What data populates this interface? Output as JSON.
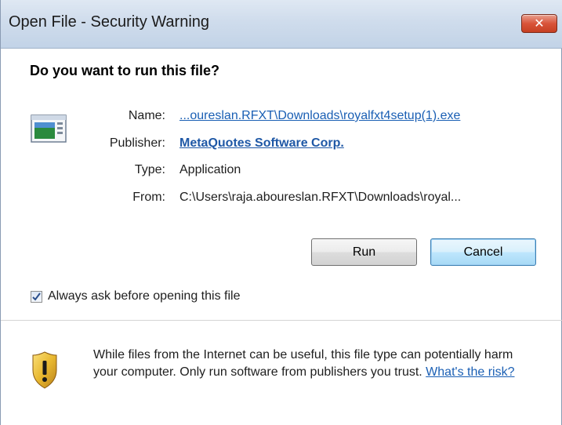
{
  "window": {
    "title": "Open File - Security Warning"
  },
  "dialog": {
    "question": "Do you want to run this file?",
    "fields": {
      "name_label": "Name:",
      "name_value": "...oureslan.RFXT\\Downloads\\royalfxt4setup(1).exe",
      "publisher_label": "Publisher:",
      "publisher_value": "MetaQuotes Software Corp.",
      "type_label": "Type:",
      "type_value": "Application",
      "from_label": "From:",
      "from_value": "C:\\Users\\raja.aboureslan.RFXT\\Downloads\\royal..."
    },
    "buttons": {
      "run": "Run",
      "cancel": "Cancel"
    },
    "checkbox": {
      "label": "Always ask before opening this file",
      "checked": true
    },
    "warning": {
      "text": "While files from the Internet can be useful, this file type can potentially harm your computer. Only run software from publishers you trust. ",
      "link": "What's the risk?"
    }
  },
  "icons": {
    "close": "close-icon",
    "file": "application-file-icon",
    "warning": "shield-warning-icon",
    "check": "checkmark-icon"
  },
  "colors": {
    "link": "#1a5fb4",
    "close_button": "#d9543a",
    "shield_gold": "#e8b830"
  }
}
